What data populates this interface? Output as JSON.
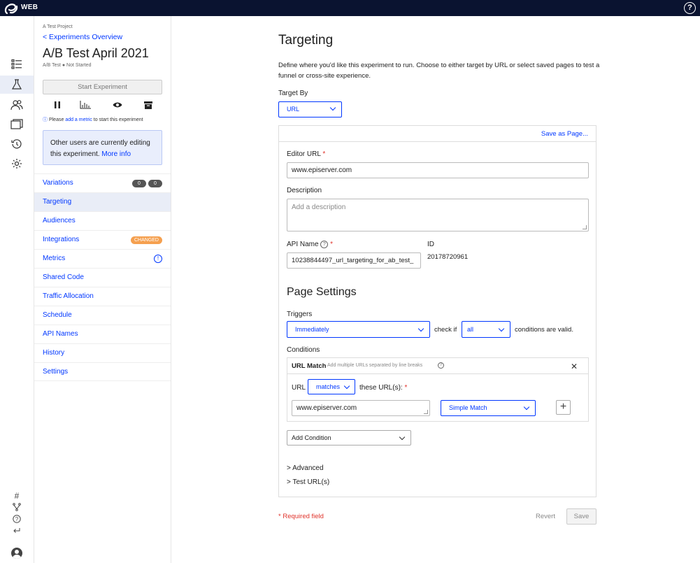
{
  "topbar": {
    "app_name": "WEB",
    "help_glyph": "?"
  },
  "rail": {
    "icons": [
      "list-icon",
      "flask-icon",
      "audience-icon",
      "pages-icon",
      "history-icon",
      "gear-icon"
    ],
    "bottom_icons": [
      "hash-icon",
      "branch-icon",
      "help-icon",
      "return-icon",
      "user-avatar-icon"
    ]
  },
  "sidebar": {
    "project": "A Test Project",
    "back_label": "< Experiments Overview",
    "title": "A/B Test April 2021",
    "meta": "A/B Test ● Not Started",
    "start_button": "Start Experiment",
    "please_prefix": "Please ",
    "please_link": "add a metric",
    "please_suffix": " to start this experiment",
    "info_text": "Other users are currently editing this experiment. ",
    "info_link": "More info",
    "nav": [
      {
        "label": "Variations",
        "badges": [
          "0",
          "0"
        ]
      },
      {
        "label": "Targeting",
        "active": true
      },
      {
        "label": "Audiences"
      },
      {
        "label": "Integrations",
        "tag": "CHANGED"
      },
      {
        "label": "Metrics",
        "alert": "!"
      },
      {
        "label": "Shared Code"
      },
      {
        "label": "Traffic Allocation"
      },
      {
        "label": "Schedule"
      },
      {
        "label": "API Names"
      },
      {
        "label": "History"
      },
      {
        "label": "Settings"
      }
    ]
  },
  "main": {
    "title": "Targeting",
    "description": "Define where you'd like this experiment to run. Choose to either target by URL or select saved pages to test a funnel or cross-site experience.",
    "target_by_label": "Target By",
    "target_by_value": "URL",
    "save_as_page": "Save as Page...",
    "editor_url_label": "Editor URL",
    "required_mark": "*",
    "editor_url_value": "www.episerver.com",
    "description_label": "Description",
    "description_placeholder": "Add a description",
    "api_name_label": "API Name",
    "api_name_value": "10238844497_url_targeting_for_ab_test_",
    "id_label": "ID",
    "id_value": "20178720961",
    "page_settings_title": "Page Settings",
    "triggers_label": "Triggers",
    "trigger_value": "Immediately",
    "check_if": "check if",
    "conditions_match": "all",
    "conditions_valid": "conditions are valid.",
    "conditions_label": "Conditions",
    "url_match_title": "URL Match",
    "url_match_hint": "Add multiple URLs separated by line breaks",
    "url_word": "URL",
    "match_type": "matches",
    "these_urls": "these URL(s):",
    "url_value": "www.episerver.com",
    "match_mode": "Simple Match",
    "add_condition": "Add Condition",
    "advanced": "> Advanced",
    "test_urls": "> Test URL(s)",
    "required_field": "* Required field",
    "revert": "Revert",
    "save": "Save"
  }
}
